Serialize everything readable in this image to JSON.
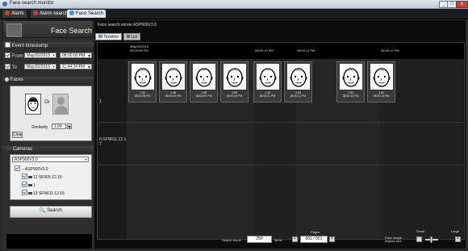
{
  "window": {
    "title": "Face search monitor",
    "min_label": "_",
    "max_label": "□",
    "close_label": "x"
  },
  "tabs": [
    {
      "label": "Alarm",
      "color": "#c9433b",
      "active": false
    },
    {
      "label": "Alarm search",
      "color": "#c9433b",
      "active": false
    },
    {
      "label": "Face Search",
      "color": "#4b8ad6",
      "active": true
    }
  ],
  "left": {
    "logo_title": "Face Search",
    "event_timestamp": {
      "header": "Event timestamp",
      "from_label": "From",
      "from_date": "May/20/2015",
      "from_time": "08:00:00 PM",
      "to_label": "To",
      "to_date": "May/20/2015",
      "to_time": "11:44:24 PM"
    },
    "faces": {
      "header": "Faces",
      "or_label": "Or",
      "similarity_label": "Similarity",
      "similarity_value": "1.04",
      "clear_label": "Clear"
    },
    "cameras": {
      "header": "Cameras",
      "selected_server": "ASP900V3.0",
      "tree": [
        {
          "label": "ASP900V3.0",
          "level": 0
        },
        {
          "label": "12 SF905.12.15",
          "level": 1
        },
        {
          "label": "1",
          "level": 1
        },
        {
          "label": "13 SFN611.12.16",
          "level": 1
        }
      ]
    },
    "search_label": "Search"
  },
  "right": {
    "server_label": "Face search server:ASP900V3.0",
    "view_tabs": [
      {
        "label": "Timeline",
        "active": true
      },
      {
        "label": "List",
        "active": false
      }
    ],
    "time_headers": [
      {
        "date": "May/20/2015",
        "time": "08:00:08 PM"
      },
      {
        "date": "",
        "time": "08:00:10 PM"
      },
      {
        "date": "",
        "time": "08:00:11 PM"
      },
      {
        "date": "",
        "time": "08:00:12 PM"
      }
    ],
    "rows": [
      {
        "label": "1"
      },
      {
        "label": "6.SFN611.12.1 7"
      }
    ],
    "faces": [
      {
        "score": "1.30",
        "time": "08:00:08 PM"
      },
      {
        "score": "1.48",
        "time": "08:00:09 PM"
      },
      {
        "score": "1.59",
        "time": "08:00:09 PM"
      },
      {
        "score": "1.58",
        "time": "08:00:10 PM"
      },
      {
        "score": "1.48",
        "time": "08:00:11 PM"
      },
      {
        "score": "1.59",
        "time": "08:00:11 PM"
      },
      {
        "score": "1.53",
        "time": "08:00:12 PM"
      },
      {
        "score": "1.61",
        "time": "08:00:12 PM"
      }
    ],
    "footer": {
      "search_result_label": "Search result",
      "search_result_value": "250",
      "items_label": "items",
      "pages_label": "Pages",
      "page_value": "001 / 001",
      "face_size_label": "Face image display size",
      "small_label": "Small",
      "large_label": "Large",
      "prev_label": "<",
      "next_label": ">",
      "minus_label": "-",
      "plus_label": "+"
    }
  }
}
